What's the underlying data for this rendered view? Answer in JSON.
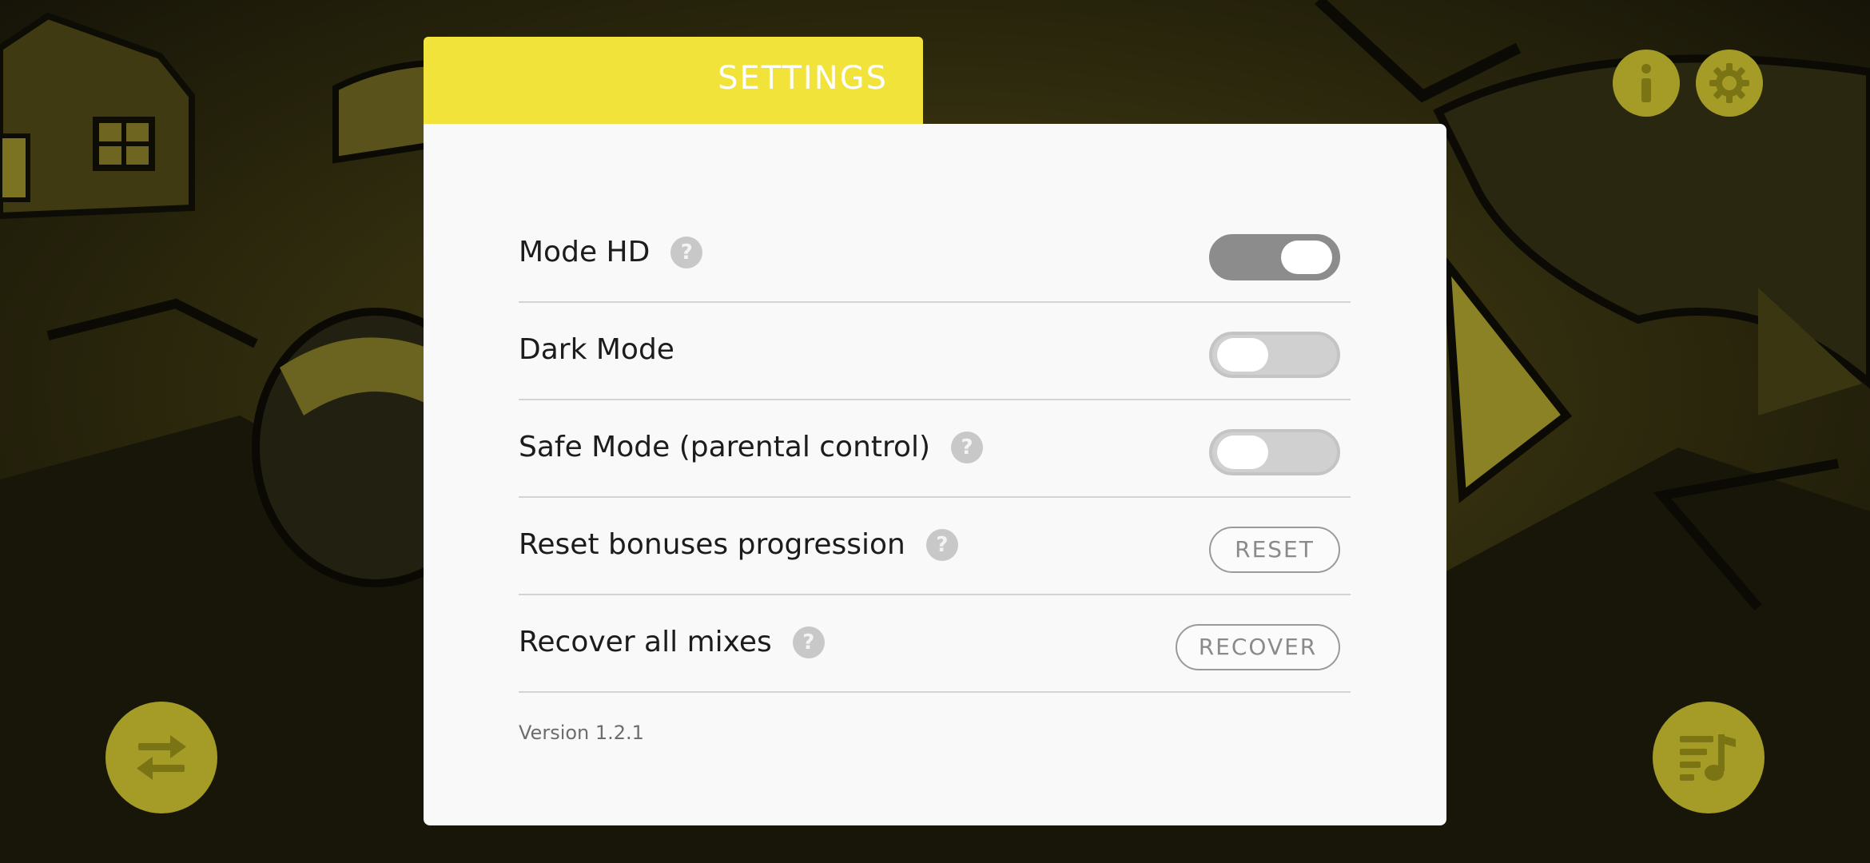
{
  "dialog": {
    "tab_title": "SETTINGS",
    "rows": [
      {
        "label": "Mode HD",
        "has_help": true,
        "control": "toggle",
        "on": true
      },
      {
        "label": "Dark Mode",
        "has_help": false,
        "control": "toggle",
        "on": false
      },
      {
        "label": "Safe Mode (parental control)",
        "has_help": true,
        "control": "toggle",
        "on": false
      },
      {
        "label": "Reset bonuses progression",
        "has_help": true,
        "control": "button",
        "button_label": "RESET"
      },
      {
        "label": "Recover all mixes",
        "has_help": true,
        "control": "button",
        "button_label": "RECOVER"
      }
    ],
    "help_glyph": "?",
    "version": "Version 1.2.1"
  },
  "top_right": {
    "info_icon": "info-icon",
    "settings_icon": "gear-icon"
  },
  "bottom": {
    "left_icon": "swap-arrows-icon",
    "right_icon": "playlist-music-icon"
  },
  "colors": {
    "accent": "#f2e33a",
    "fab": "#a49c26",
    "panel": "#f9f9f9"
  }
}
